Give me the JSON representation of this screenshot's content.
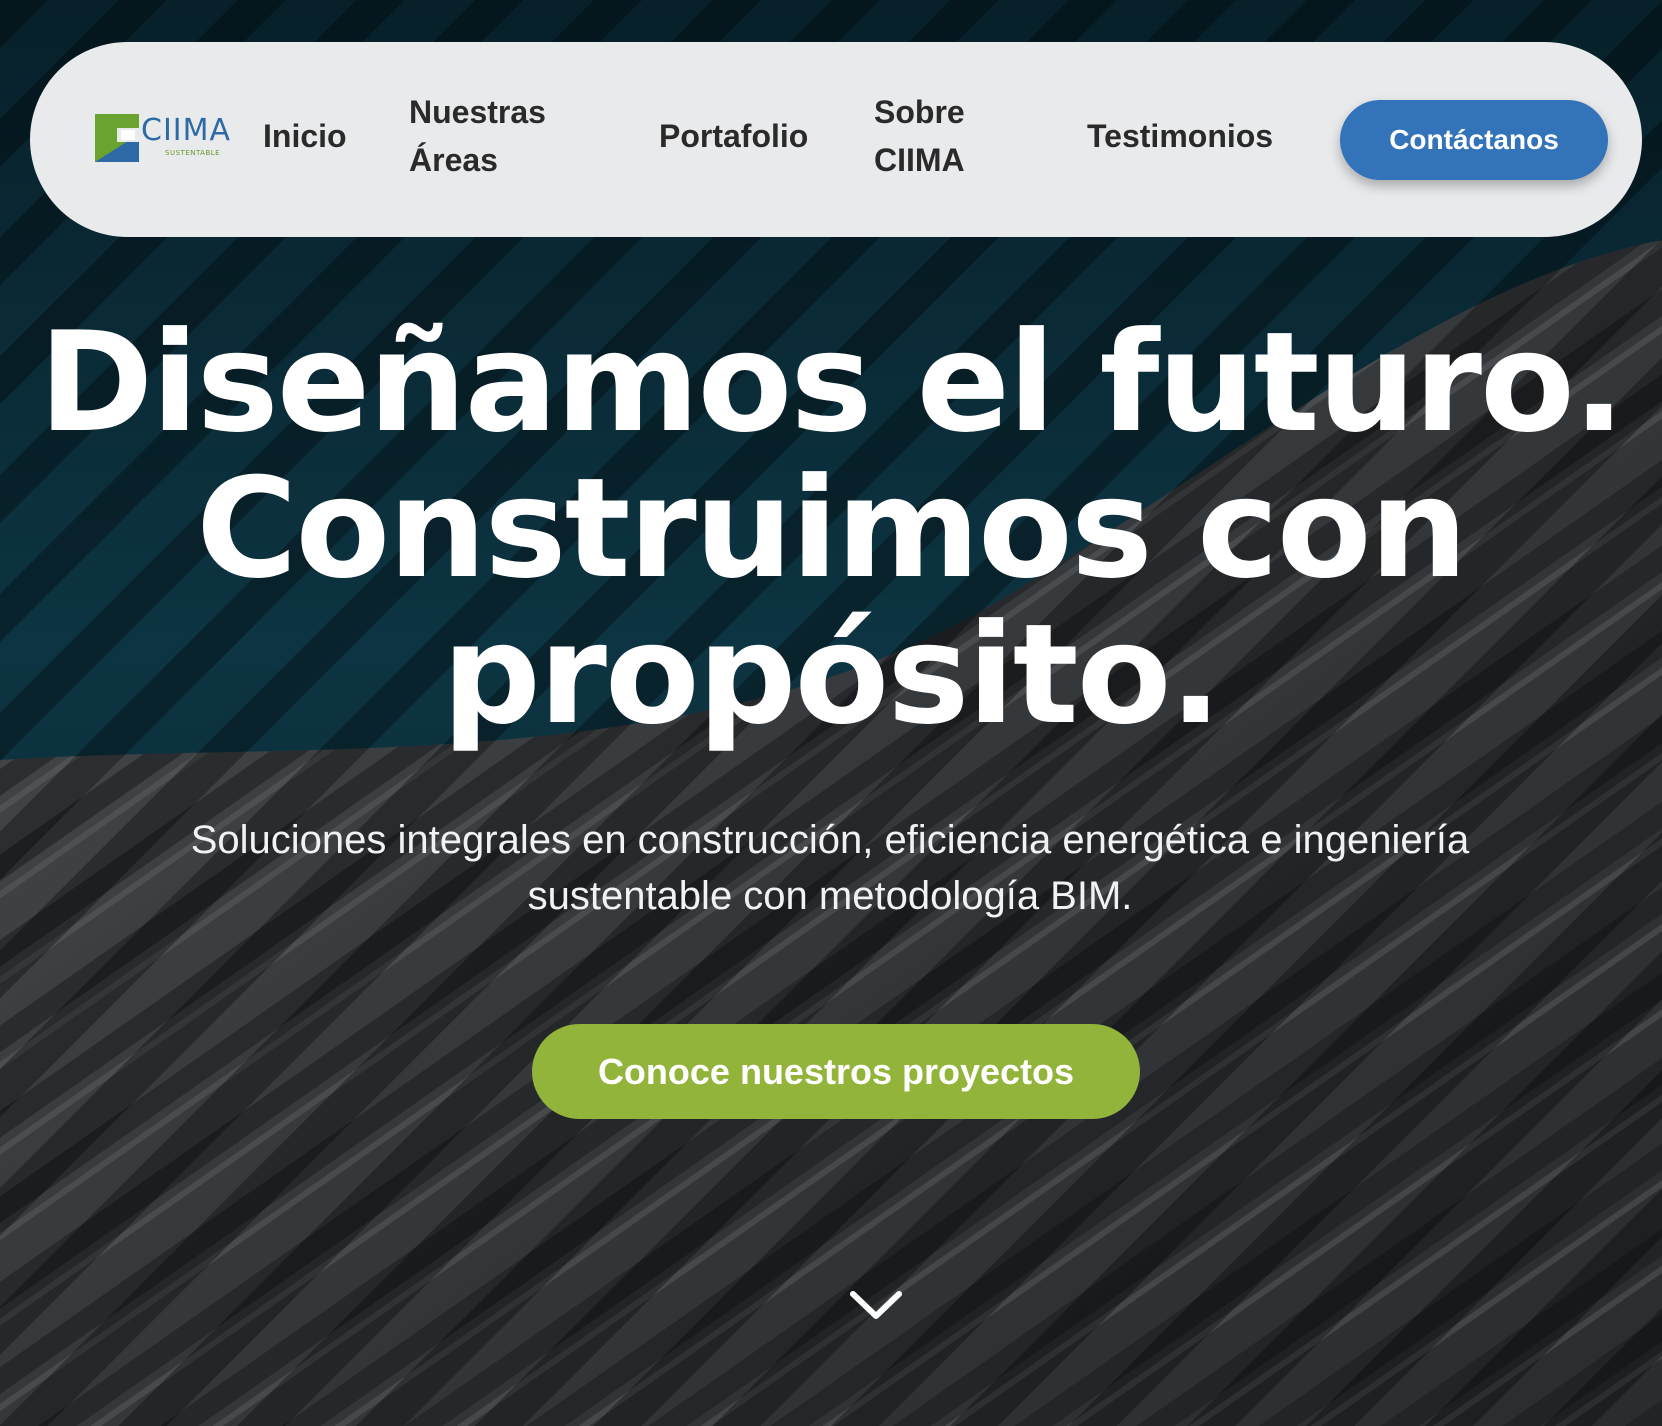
{
  "nav": {
    "logo": {
      "name": "CIIMA",
      "tagline": "SUSTENTABLE"
    },
    "links": {
      "inicio": "Inicio",
      "areas_line1": "Nuestras",
      "areas_line2": "Áreas",
      "portafolio": "Portafolio",
      "sobre_line1": "Sobre",
      "sobre_line2": "CIIMA",
      "testimonios": "Testimonios"
    },
    "cta_label": "Contáctanos"
  },
  "hero": {
    "headline_lines": [
      "Diseñamos el futuro.",
      "Construimos con",
      "propósito."
    ],
    "subtitle_line1": "Soluciones integrales en construcción, eficiencia energética e ingeniería",
    "subtitle_line2": "sustentable con metodología BIM.",
    "cta_label": "Conoce nuestros proyectos",
    "scroll_icon": "chevron-down-icon"
  },
  "colors": {
    "nav_background": "#e8eaec",
    "contact_button": "#3373b9",
    "projects_button": "#93b43a",
    "sky_dark": "#0b2a36",
    "facade_grey": "#3b3d3f",
    "logo_blue": "#2d6aa6",
    "logo_green": "#6aa32f"
  }
}
